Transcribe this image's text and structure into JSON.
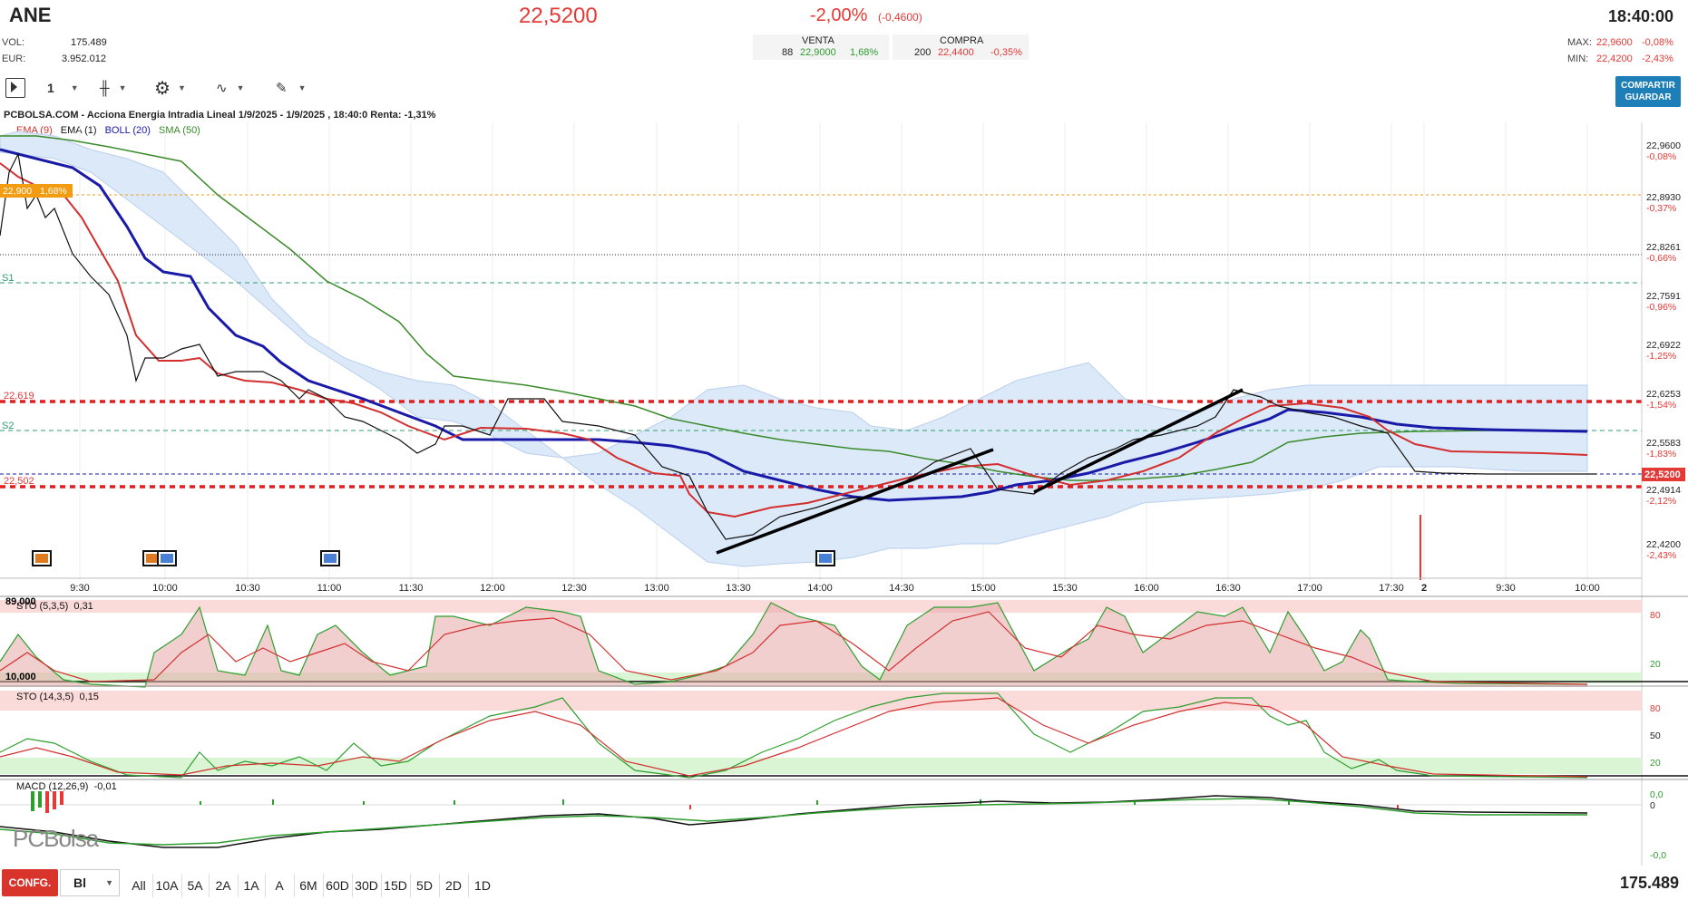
{
  "header": {
    "ticker": "ANE",
    "price": "22,5200",
    "change_pct": "-2,00%",
    "change_abs": "(-0,4600)",
    "time": "18:40:00",
    "vol_label": "VOL:",
    "vol_value": "175.489",
    "eur_label": "EUR:",
    "eur_value": "3.952.012",
    "venta_label": "VENTA",
    "venta_qty": "88",
    "venta_price": "22,9000",
    "venta_pct": "1,68%",
    "compra_label": "COMPRA",
    "compra_qty": "200",
    "compra_price": "22,4400",
    "compra_pct": "-0,35%",
    "max_label": "MAX:",
    "max_value": "22,9600",
    "max_pct": "-0,08%",
    "min_label": "MIN:",
    "min_value": "22,4200",
    "min_pct": "-2,43%"
  },
  "toolbar": {
    "interval_value": "1",
    "share_label_1": "COMPARTIR",
    "share_label_2": "GUARDAR"
  },
  "chart": {
    "title": "PCBOLSA.COM - Acciona Energia Intradia Lineal 1/9/2025 - 1/9/2025 , 18:40:0 Renta: -1,31%",
    "legend": [
      "EMA (9)",
      "EMA (1)",
      "BOLL (20)",
      "SMA (50)"
    ],
    "price_tag": "22,900",
    "price_tag_pct": "1,68%",
    "line_labels": {
      "s1": "S1",
      "s2": "S2",
      "r1": "22,619",
      "r2": "22,502"
    },
    "right_axis": [
      {
        "v": "22,9600",
        "p": "-0,08%"
      },
      {
        "v": "22,8930",
        "p": "-0,37%"
      },
      {
        "v": "22,8261",
        "p": "-0,66%"
      },
      {
        "v": "22,7591",
        "p": "-0,96%"
      },
      {
        "v": "22,6922",
        "p": "-1,25%"
      },
      {
        "v": "22,6253",
        "p": "-1,54%"
      },
      {
        "v": "22,5583",
        "p": "-1,83%"
      },
      {
        "v": "22,4914",
        "p": "-2,12%"
      },
      {
        "v": "22,4200",
        "p": "-2,43%"
      }
    ],
    "last_price_tag": "22,5200",
    "x_axis": [
      "9:30",
      "10:00",
      "10:30",
      "11:00",
      "11:30",
      "12:00",
      "12:30",
      "13:00",
      "13:30",
      "14:00",
      "14:30",
      "15:00",
      "15:30",
      "16:00",
      "16:30",
      "17:00",
      "17:30",
      "2",
      "9:30",
      "10:00"
    ]
  },
  "sto1": {
    "label": "STO (5,3,5)",
    "value": "0,31",
    "top_level": "89,000",
    "bottom_level": "10,000",
    "ticks": [
      "80",
      "20"
    ]
  },
  "sto2": {
    "label": "STO (14,3,5)",
    "value": "0,15",
    "ticks": [
      "80",
      "50",
      "20"
    ]
  },
  "macd": {
    "label": "MACD (12,26,9)",
    "value": "-0,01",
    "ticks": [
      "0,0",
      "0",
      "-0,0"
    ]
  },
  "logo": "PCBolsa",
  "bottom": {
    "config": "CONFG.",
    "mode": "Bl",
    "periods": [
      "All",
      "10A",
      "5A",
      "2A",
      "1A",
      "A",
      "6M",
      "60D",
      "30D",
      "15D",
      "5D",
      "2D",
      "1D"
    ],
    "volume": "175.489"
  },
  "colors": {
    "ema9": "#d32f2f",
    "ema1": "#111111",
    "boll": "#1a1aa8",
    "sma50": "#3a8a2a",
    "band": "#dce9f8",
    "accent": "#1e7fb8"
  }
}
